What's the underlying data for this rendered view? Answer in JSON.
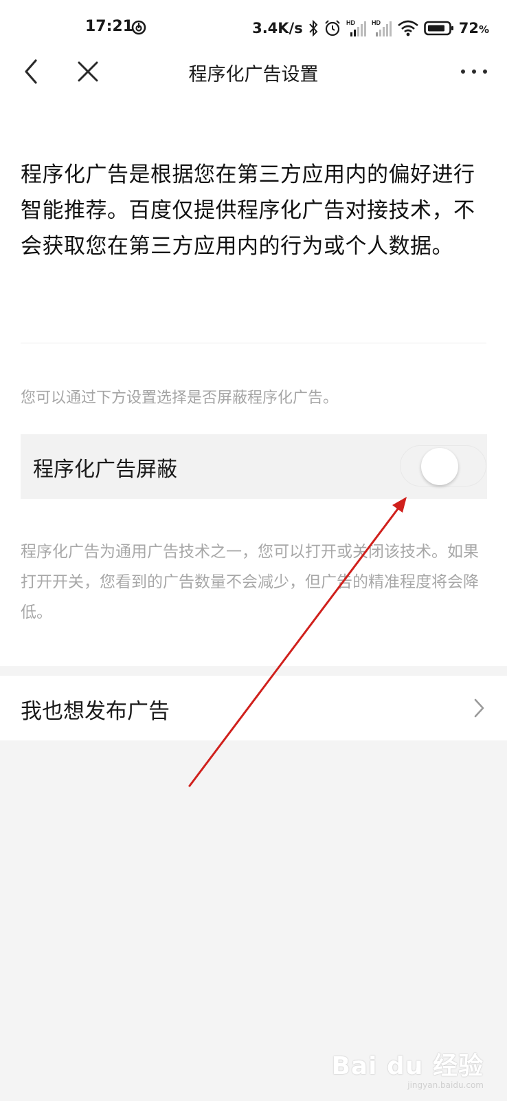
{
  "status_bar": {
    "time": "17:21",
    "net_speed": "3.4K/s",
    "battery_value": "72",
    "battery_unit": "%",
    "icons": [
      "netease-music-icon",
      "bluetooth-icon",
      "alarm-icon",
      "hd-signal-icon",
      "hd-signal-icon",
      "wifi-icon",
      "battery-icon"
    ]
  },
  "nav": {
    "title": "程序化广告设置",
    "icons": [
      "back-icon",
      "close-icon",
      "more-icon"
    ]
  },
  "intro_text": "程序化广告是根据您在第三方应用内的偏好进行智能推荐。百度仅提供程序化广告对接技术，不会获取您在第三方应用内的行为或个人数据。",
  "hint_text": "您可以通过下方设置选择是否屏蔽程序化广告。",
  "toggle": {
    "label": "程序化广告屏蔽",
    "checked": false
  },
  "description": "程序化广告为通用广告技术之一，您可以打开或关闭该技术。如果打开开关，您看到的广告数量不会减少，但广告的精准程度将会降低。",
  "publish_row": {
    "label": "我也想发布广告"
  },
  "annotation": {
    "arrow_color": "#d0201c"
  },
  "watermark": {
    "main": "Bai du 经验",
    "sub": "jingyan.baidu.com"
  }
}
